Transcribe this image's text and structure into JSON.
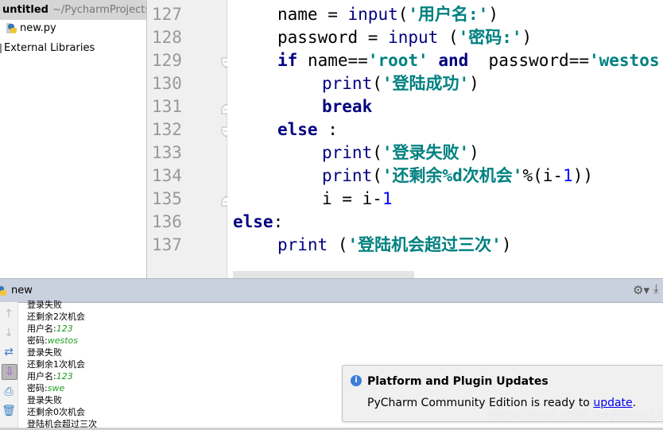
{
  "project": {
    "name": "untitled",
    "path": "~/PycharmProjects",
    "items": [
      {
        "label": "new.py",
        "icon": "python-file-icon"
      },
      {
        "label": "External Libraries",
        "icon": "library-icon"
      }
    ]
  },
  "editor": {
    "current_line": "137",
    "lines": [
      {
        "no": "127",
        "indent": 1,
        "tokens": [
          {
            "t": "name = ",
            "c": ""
          },
          {
            "t": "input",
            "c": "fn"
          },
          {
            "t": "(",
            "c": ""
          },
          {
            "t": "'用户名:'",
            "c": "str"
          },
          {
            "t": ")",
            "c": ""
          }
        ]
      },
      {
        "no": "128",
        "indent": 1,
        "tokens": [
          {
            "t": "password = ",
            "c": ""
          },
          {
            "t": "input",
            "c": "fn"
          },
          {
            "t": " (",
            "c": ""
          },
          {
            "t": "'密码:'",
            "c": "str"
          },
          {
            "t": ")",
            "c": ""
          }
        ]
      },
      {
        "no": "129",
        "indent": 1,
        "tokens": [
          {
            "t": "if",
            "c": "kw"
          },
          {
            "t": " name==",
            "c": ""
          },
          {
            "t": "'root'",
            "c": "str"
          },
          {
            "t": " ",
            "c": ""
          },
          {
            "t": "and",
            "c": "kw"
          },
          {
            "t": "  password==",
            "c": ""
          },
          {
            "t": "'westos'",
            "c": "str"
          },
          {
            "t": ":",
            "c": ""
          }
        ]
      },
      {
        "no": "130",
        "indent": 2,
        "tokens": [
          {
            "t": "print",
            "c": "fn"
          },
          {
            "t": "(",
            "c": ""
          },
          {
            "t": "'登陆成功'",
            "c": "str"
          },
          {
            "t": ")",
            "c": ""
          }
        ]
      },
      {
        "no": "131",
        "indent": 2,
        "tokens": [
          {
            "t": "break",
            "c": "kw"
          }
        ]
      },
      {
        "no": "132",
        "indent": 1,
        "tokens": [
          {
            "t": "else",
            "c": "kw"
          },
          {
            "t": " :",
            "c": ""
          }
        ]
      },
      {
        "no": "133",
        "indent": 2,
        "tokens": [
          {
            "t": "print",
            "c": "fn"
          },
          {
            "t": "(",
            "c": ""
          },
          {
            "t": "'登录失败'",
            "c": "str"
          },
          {
            "t": ")",
            "c": ""
          }
        ]
      },
      {
        "no": "134",
        "indent": 2,
        "tokens": [
          {
            "t": "print",
            "c": "fn"
          },
          {
            "t": "(",
            "c": ""
          },
          {
            "t": "'还剩余%d次机会'",
            "c": "str"
          },
          {
            "t": "%(i-",
            "c": ""
          },
          {
            "t": "1",
            "c": "num"
          },
          {
            "t": "))",
            "c": ""
          }
        ]
      },
      {
        "no": "135",
        "indent": 2,
        "tokens": [
          {
            "t": "i = i-",
            "c": ""
          },
          {
            "t": "1",
            "c": "num"
          }
        ]
      },
      {
        "no": "136",
        "indent": 0,
        "tokens": [
          {
            "t": "else",
            "c": "kw"
          },
          {
            "t": ":",
            "c": ""
          }
        ]
      },
      {
        "no": "137",
        "indent": 1,
        "tokens": [
          {
            "t": "print",
            "c": "fn"
          },
          {
            "t": " (",
            "c": ""
          },
          {
            "t": "'登陆机会超过三次'",
            "c": "str"
          },
          {
            "t": ")",
            "c": ""
          }
        ]
      }
    ]
  },
  "run": {
    "title": "new",
    "console": [
      {
        "prompt": "登录失败",
        "input": ""
      },
      {
        "prompt": "还剩余2次机会",
        "input": ""
      },
      {
        "prompt": "用户名:",
        "input": "123"
      },
      {
        "prompt": "密码:",
        "input": "westos"
      },
      {
        "prompt": "登录失败",
        "input": ""
      },
      {
        "prompt": "还剩余1次机会",
        "input": ""
      },
      {
        "prompt": "用户名:",
        "input": "123"
      },
      {
        "prompt": "密码:",
        "input": "swe"
      },
      {
        "prompt": "登录失败",
        "input": ""
      },
      {
        "prompt": "还剩余0次机会",
        "input": ""
      },
      {
        "prompt": "登陆机会超过三次",
        "input": ""
      }
    ]
  },
  "notification": {
    "title": "Platform and Plugin Updates",
    "message_prefix": "PyCharm Community Edition is ready to ",
    "link": "update",
    "message_suffix": "."
  },
  "watermark": "https://blog.csdn.net/qwqq233"
}
